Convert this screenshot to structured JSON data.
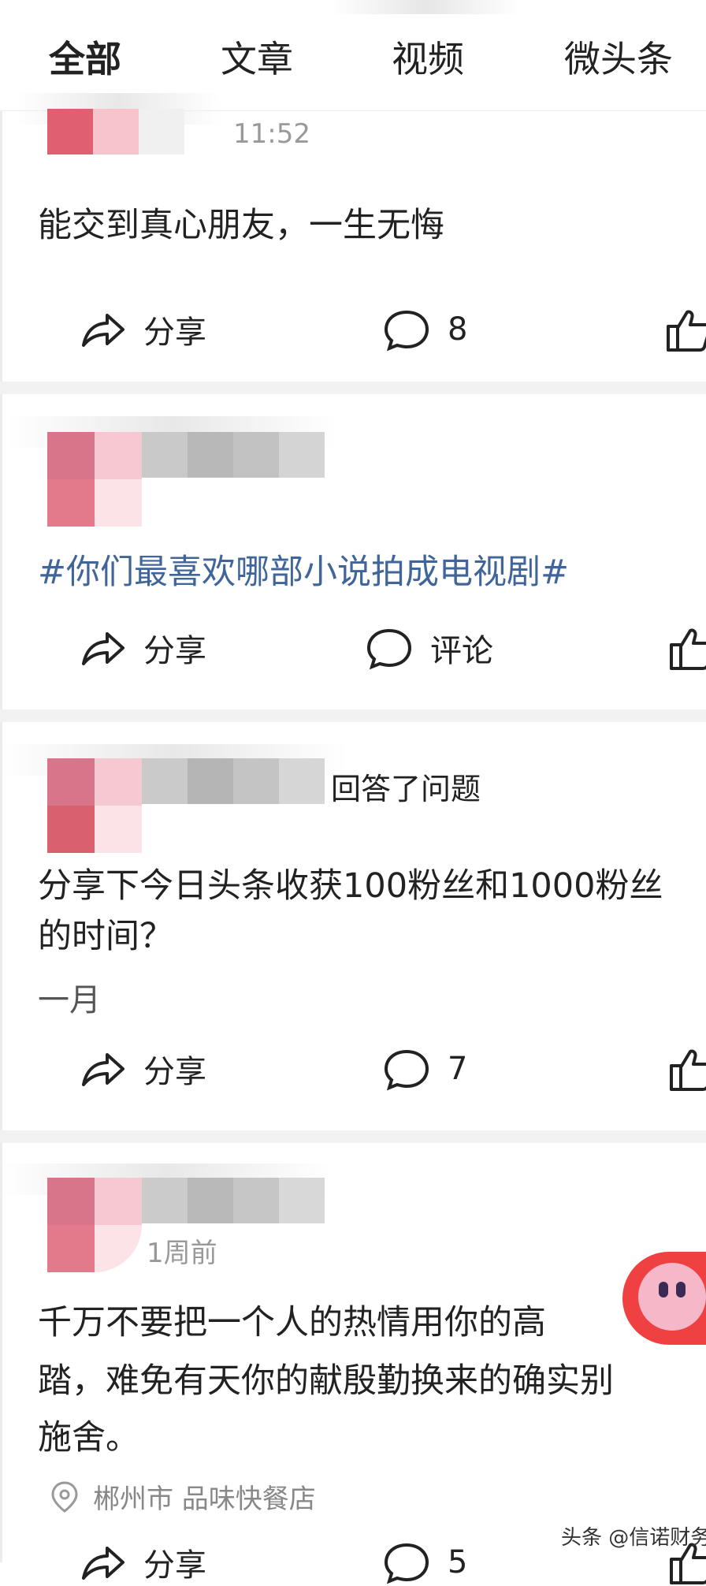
{
  "tabs": [
    {
      "label": "全部",
      "active": true
    },
    {
      "label": "文章",
      "active": false
    },
    {
      "label": "视频",
      "active": false
    },
    {
      "label": "微头条",
      "active": false
    }
  ],
  "posts": [
    {
      "time": "11:52",
      "content": "能交到真心朋友，一生无悔",
      "share_label": "分享",
      "comment_label": "8"
    },
    {
      "content": "#你们最喜欢哪部小说拍成电视剧#",
      "share_label": "分享",
      "comment_label": "评论"
    },
    {
      "meta": "回答了问题",
      "content_line1": "分享下今日头条收获100粉丝和1000粉丝",
      "content_line2": "的时间？",
      "answer": "一月",
      "share_label": "分享",
      "comment_label": "7"
    },
    {
      "time": "1周前",
      "content_line1": "千万不要把一个人的热情用你的高",
      "content_line2": "踏，难免有天你的献殷勤换来的确实别",
      "content_line3": "施舍。",
      "location": "郴州市  品味快餐店",
      "share_label": "分享",
      "comment_label": "5"
    }
  ],
  "watermark": "头条 @信诺财务",
  "colors": {
    "topic": "#406599",
    "separator": "#f2f2f2",
    "fab": "#f04142"
  },
  "icons": [
    "share-icon",
    "comment-icon",
    "like-icon",
    "location-icon"
  ]
}
